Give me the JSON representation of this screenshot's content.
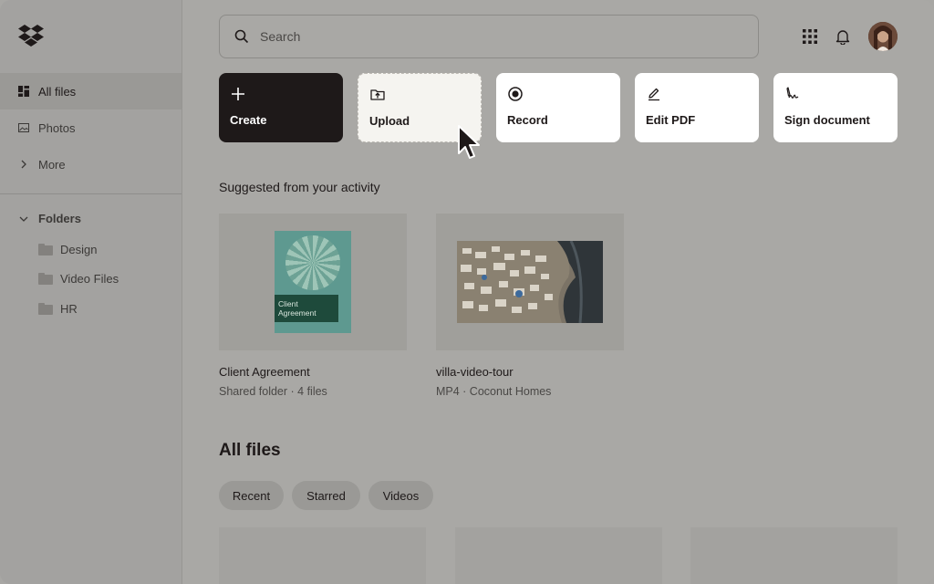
{
  "sidebar": {
    "items": [
      {
        "label": "All files",
        "icon": "grid-file-icon"
      },
      {
        "label": "Photos",
        "icon": "photo-icon"
      },
      {
        "label": "More",
        "icon": "chevron-right-icon"
      }
    ],
    "folders_heading": "Folders",
    "folders": [
      {
        "label": "Design"
      },
      {
        "label": "Video Files"
      },
      {
        "label": "HR"
      }
    ]
  },
  "search": {
    "placeholder": "Search"
  },
  "actions": [
    {
      "label": "Create",
      "icon": "plus-icon"
    },
    {
      "label": "Upload",
      "icon": "folder-upload-icon"
    },
    {
      "label": "Record",
      "icon": "record-icon"
    },
    {
      "label": "Edit PDF",
      "icon": "pencil-icon"
    },
    {
      "label": "Sign document",
      "icon": "signature-icon"
    }
  ],
  "suggested": {
    "title": "Suggested from your activity",
    "cards": [
      {
        "name": "Client Agreement",
        "meta": "Shared folder · 4 files",
        "cover_text": "Client Agreement"
      },
      {
        "name": "villa-video-tour",
        "meta": "MP4 · Coconut Homes"
      }
    ]
  },
  "all_files": {
    "title": "All files",
    "filters": [
      "Recent",
      "Starred",
      "Videos"
    ]
  },
  "colors": {
    "accent_dark": "#1e1919",
    "background": "#a9a8a5"
  }
}
